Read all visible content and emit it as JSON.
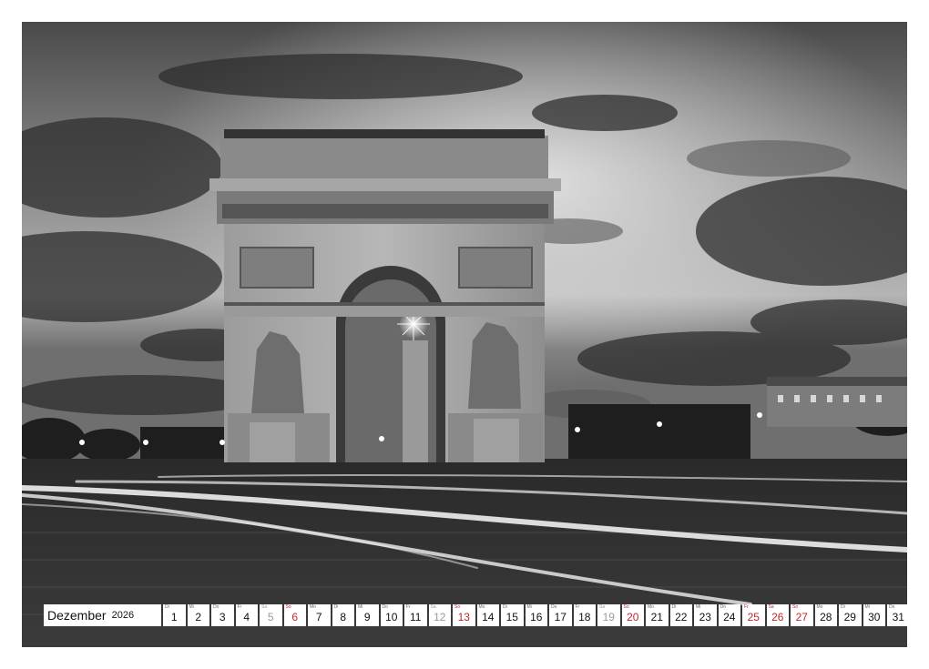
{
  "calendar": {
    "month": "Dezember",
    "year": "2026",
    "days": [
      {
        "d": "1",
        "w": "Di",
        "t": ""
      },
      {
        "d": "2",
        "w": "Mi",
        "t": ""
      },
      {
        "d": "3",
        "w": "Do",
        "t": ""
      },
      {
        "d": "4",
        "w": "Fr",
        "t": ""
      },
      {
        "d": "5",
        "w": "Sa",
        "t": "sat"
      },
      {
        "d": "6",
        "w": "So",
        "t": "hol"
      },
      {
        "d": "7",
        "w": "Mo",
        "t": ""
      },
      {
        "d": "8",
        "w": "Di",
        "t": ""
      },
      {
        "d": "9",
        "w": "Mi",
        "t": ""
      },
      {
        "d": "10",
        "w": "Do",
        "t": ""
      },
      {
        "d": "11",
        "w": "Fr",
        "t": ""
      },
      {
        "d": "12",
        "w": "Sa",
        "t": "sat"
      },
      {
        "d": "13",
        "w": "So",
        "t": "hol"
      },
      {
        "d": "14",
        "w": "Mo",
        "t": ""
      },
      {
        "d": "15",
        "w": "Di",
        "t": ""
      },
      {
        "d": "16",
        "w": "Mi",
        "t": ""
      },
      {
        "d": "17",
        "w": "Do",
        "t": ""
      },
      {
        "d": "18",
        "w": "Fr",
        "t": ""
      },
      {
        "d": "19",
        "w": "Sa",
        "t": "sat"
      },
      {
        "d": "20",
        "w": "So",
        "t": "hol"
      },
      {
        "d": "21",
        "w": "Mo",
        "t": ""
      },
      {
        "d": "22",
        "w": "Di",
        "t": ""
      },
      {
        "d": "23",
        "w": "Mi",
        "t": ""
      },
      {
        "d": "24",
        "w": "Do",
        "t": ""
      },
      {
        "d": "25",
        "w": "Fr",
        "t": "hol"
      },
      {
        "d": "26",
        "w": "Sa",
        "t": "hol"
      },
      {
        "d": "27",
        "w": "So",
        "t": "hol"
      },
      {
        "d": "28",
        "w": "Mo",
        "t": ""
      },
      {
        "d": "29",
        "w": "Di",
        "t": ""
      },
      {
        "d": "30",
        "w": "Mi",
        "t": ""
      },
      {
        "d": "31",
        "w": "Do",
        "t": ""
      }
    ]
  },
  "colors": {
    "holiday": "#c0282d",
    "saturday": "#9a9a9a",
    "binding": "#3a3a3a"
  }
}
